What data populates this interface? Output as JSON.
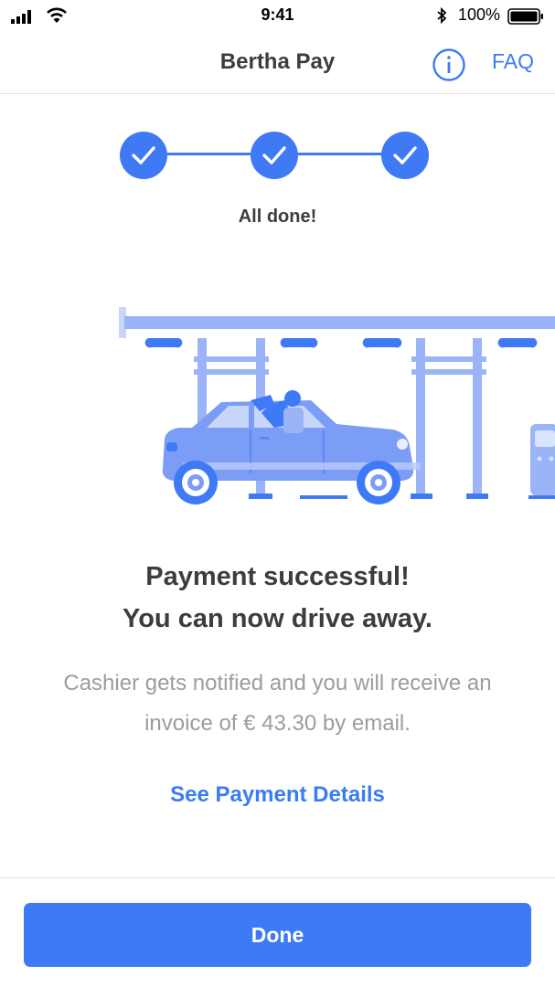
{
  "status_bar": {
    "time": "9:41",
    "battery": "100%"
  },
  "nav": {
    "title": "Bertha Pay",
    "faq_label": "FAQ"
  },
  "stepper": {
    "steps": [
      "done",
      "done",
      "done"
    ],
    "caption": "All done!"
  },
  "message": {
    "headline_line1": "Payment successful!",
    "headline_line2": "You can now drive away.",
    "description_line1": "Cashier gets notified and you will receive an",
    "description_line2": "invoice of € 43.30 by email.",
    "details_link": "See Payment Details"
  },
  "actions": {
    "done_label": "Done"
  },
  "colors": {
    "accent": "#3f7af6",
    "illustration_light": "#9bb4f8",
    "illustration_mid": "#7c9df5",
    "text_primary": "#3c3c41",
    "text_secondary": "#9b9ca3"
  }
}
